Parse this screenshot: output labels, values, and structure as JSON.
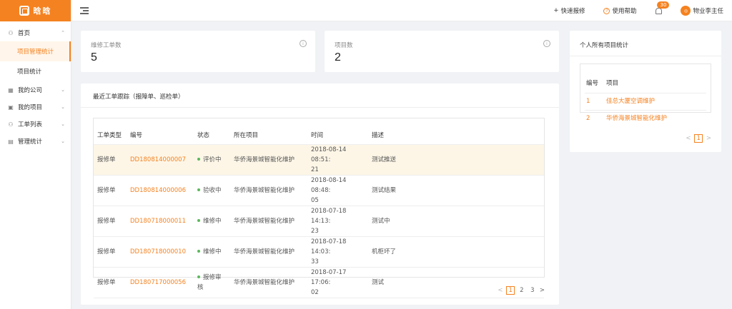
{
  "logo": {
    "text": "晗晗"
  },
  "sidebar": {
    "items": [
      {
        "label": "首页",
        "icon": "user-icon",
        "chevron": "⌃"
      },
      {
        "label": "项目管理统计",
        "sub": true,
        "active": true
      },
      {
        "label": "项目统计",
        "sub": true
      },
      {
        "label": "我的公司",
        "icon": "building-icon",
        "chevron": "⌄"
      },
      {
        "label": "我的项目",
        "icon": "project-icon",
        "chevron": "⌄"
      },
      {
        "label": "工单列表",
        "icon": "user-icon",
        "chevron": "⌄"
      },
      {
        "label": "管理统计",
        "icon": "chart-icon",
        "chevron": "⌄"
      }
    ]
  },
  "header": {
    "quick_repair": "快速报修",
    "help": "使用帮助",
    "badge_count": "30",
    "user_name": "物业李主任",
    "plus_glyph": "+",
    "help_glyph": "?"
  },
  "stats": {
    "orders_label": "维修工单数",
    "orders_value": "5",
    "projects_label": "项目数",
    "projects_value": "2",
    "info_glyph": "i"
  },
  "recent": {
    "title": "最近工单跟踪（报障单、巡检单）",
    "columns": [
      "工单类型",
      "编号",
      "状态",
      "所在项目",
      "时间",
      "描述"
    ],
    "rows": [
      {
        "type": "报修单",
        "code": "DD180814000007",
        "status": "评价中",
        "project": "华侨海景城智能化维护",
        "time1": "2018-08-14 08:51:",
        "time2": "21",
        "desc": "测试推送"
      },
      {
        "type": "报修单",
        "code": "DD180814000006",
        "status": "验收中",
        "project": "华侨海景城智能化维护",
        "time1": "2018-08-14 08:48:",
        "time2": "05",
        "desc": "测试结果"
      },
      {
        "type": "报修单",
        "code": "DD180718000011",
        "status": "维修中",
        "project": "华侨海景城智能化维护",
        "time1": "2018-07-18 14:13:",
        "time2": "23",
        "desc": "测试中"
      },
      {
        "type": "报修单",
        "code": "DD180718000010",
        "status": "维修中",
        "project": "华侨海景城智能化维护",
        "time1": "2018-07-18 14:03:",
        "time2": "33",
        "desc": "机柜坏了"
      },
      {
        "type": "报修单",
        "code": "DD180717000056",
        "status1": "报修审",
        "status2": "核",
        "project": "华侨海景城智能化维护",
        "time1": "2018-07-17 17:06:",
        "time2": "02",
        "desc": "测试"
      }
    ],
    "pagination": {
      "prev": "<",
      "pages": [
        "1",
        "2",
        "3"
      ],
      "next": ">"
    }
  },
  "personal": {
    "title": "个人所有项目统计",
    "columns": [
      "编号",
      "项目"
    ],
    "rows": [
      {
        "no": "1",
        "name": "佳总大厦空调维护"
      },
      {
        "no": "2",
        "name": "华侨海景城智能化维护"
      }
    ],
    "pagination": {
      "prev": "<",
      "current": "1",
      "next": ">"
    }
  },
  "colors": {
    "accent": "#f58220",
    "status_dot": "#5cb85c",
    "highlight_row": "#fdf6e7"
  }
}
